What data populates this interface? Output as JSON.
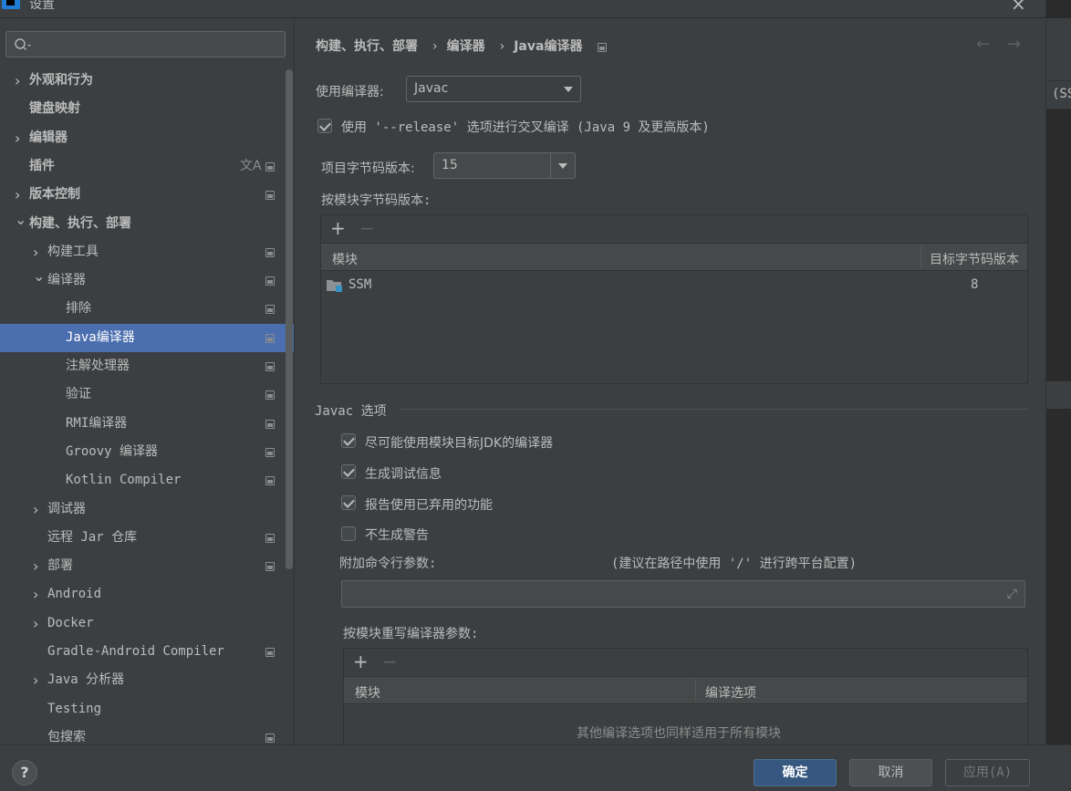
{
  "window": {
    "title": "设置",
    "close_icon": "×",
    "logo_icon": "intellij-logo"
  },
  "background_ide": {
    "fragment": "(SS"
  },
  "sidebar": {
    "search": {
      "value": "",
      "placeholder": ""
    },
    "items": [
      {
        "label": "外观和行为",
        "expandable": true,
        "expanded": false,
        "level": 0
      },
      {
        "label": "键盘映射",
        "expandable": false,
        "level": 0
      },
      {
        "label": "编辑器",
        "expandable": true,
        "expanded": false,
        "level": 0
      },
      {
        "label": "插件",
        "expandable": false,
        "level": 0,
        "translate_icon": "文A"
      },
      {
        "label": "版本控制",
        "expandable": true,
        "expanded": false,
        "level": 0
      },
      {
        "label": "构建、执行、部署",
        "expandable": true,
        "expanded": true,
        "level": 0
      },
      {
        "label": "构建工具",
        "expandable": true,
        "expanded": false,
        "level": 1
      },
      {
        "label": "编译器",
        "expandable": true,
        "expanded": true,
        "level": 1
      },
      {
        "label": "排除",
        "expandable": false,
        "level": 2
      },
      {
        "label": "Java编译器",
        "expandable": false,
        "level": 2,
        "selected": true
      },
      {
        "label": "注解处理器",
        "expandable": false,
        "level": 2
      },
      {
        "label": "验证",
        "expandable": false,
        "level": 2
      },
      {
        "label": "RMI编译器",
        "expandable": false,
        "level": 2
      },
      {
        "label": "Groovy 编译器",
        "expandable": false,
        "level": 2
      },
      {
        "label": "Kotlin Compiler",
        "expandable": false,
        "level": 2
      },
      {
        "label": "调试器",
        "expandable": true,
        "expanded": false,
        "level": 1
      },
      {
        "label": "远程 Jar 仓库",
        "expandable": false,
        "level": 1
      },
      {
        "label": "部署",
        "expandable": true,
        "expanded": false,
        "level": 1
      },
      {
        "label": "Android",
        "expandable": true,
        "expanded": false,
        "level": 1
      },
      {
        "label": "Docker",
        "expandable": true,
        "expanded": false,
        "level": 1
      },
      {
        "label": "Gradle-Android Compiler",
        "expandable": false,
        "level": 1
      },
      {
        "label": "Java 分析器",
        "expandable": true,
        "expanded": false,
        "level": 1
      },
      {
        "label": "Testing",
        "expandable": false,
        "level": 1
      },
      {
        "label": "包搜索",
        "expandable": false,
        "level": 1
      }
    ]
  },
  "breadcrumb": [
    "构建、执行、部署",
    "编译器",
    "Java编译器"
  ],
  "nav": {
    "back_icon": "←",
    "forward_icon": "→"
  },
  "compiler": {
    "use_compiler_label": "使用编译器:",
    "use_compiler_value": "Javac",
    "release_option_label": "使用 '--release' 选项进行交叉编译 (Java 9 及更高版本)",
    "release_option_checked": true,
    "project_bytecode_label": "项目字节码版本:",
    "project_bytecode_value": "15",
    "per_module_label": "按模块字节码版本:",
    "module_table": {
      "add": "+",
      "remove": "−",
      "columns": [
        "模块",
        "目标字节码版本"
      ],
      "rows": [
        {
          "module": "SSM",
          "version": "8"
        }
      ]
    }
  },
  "javac": {
    "section_title": "Javac 选项",
    "options": [
      {
        "label": "尽可能使用模块目标JDK的编译器",
        "checked": true
      },
      {
        "label": "生成调试信息",
        "checked": true
      },
      {
        "label": "报告使用已弃用的功能",
        "checked": true
      },
      {
        "label": "不生成警告",
        "checked": false
      }
    ],
    "cmd_params_label": "附加命令行参数:",
    "cmd_params_hint": "(建议在路径中使用 '/' 进行跨平台配置)",
    "cmd_params_value": "",
    "override_label": "按模块重写编译器参数:",
    "override_table": {
      "add": "+",
      "remove": "−",
      "columns": [
        "模块",
        "编译选项"
      ],
      "empty_text": "其他编译选项也同样适用于所有模块"
    }
  },
  "footer": {
    "help": "?",
    "ok": "确定",
    "cancel": "取消",
    "apply": "应用(A)"
  }
}
